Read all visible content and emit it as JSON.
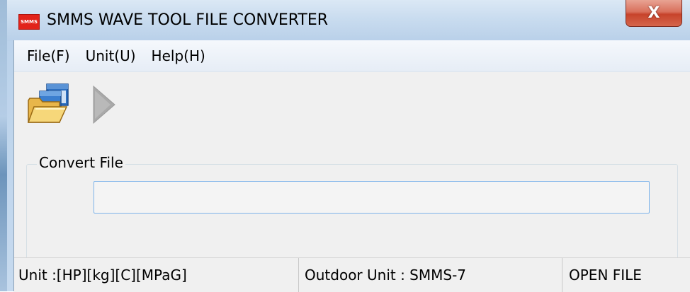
{
  "window": {
    "title": "SMMS WAVE TOOL FILE CONVERTER",
    "app_icon_text": "SMMS",
    "close_glyph": "X"
  },
  "menu": {
    "items": [
      {
        "label": "File(F)"
      },
      {
        "label": "Unit(U)"
      },
      {
        "label": "Help(H)"
      }
    ]
  },
  "toolbar": {
    "buttons": [
      {
        "icon": "open-folder-icon"
      },
      {
        "icon": "play-icon",
        "enabled": false
      }
    ]
  },
  "convert_group": {
    "label": "Convert File",
    "path_value": ""
  },
  "status": {
    "unit": "Unit :[HP][kg][C][MPaG]",
    "outdoor": "Outdoor Unit : SMMS-7",
    "action": "OPEN FILE"
  },
  "colors": {
    "titlebar": "#c9dcef",
    "close_button": "#c7432b",
    "icon_red": "#e2231a",
    "field_border": "#7eb4ea",
    "client_bg": "#f0f0f0"
  }
}
